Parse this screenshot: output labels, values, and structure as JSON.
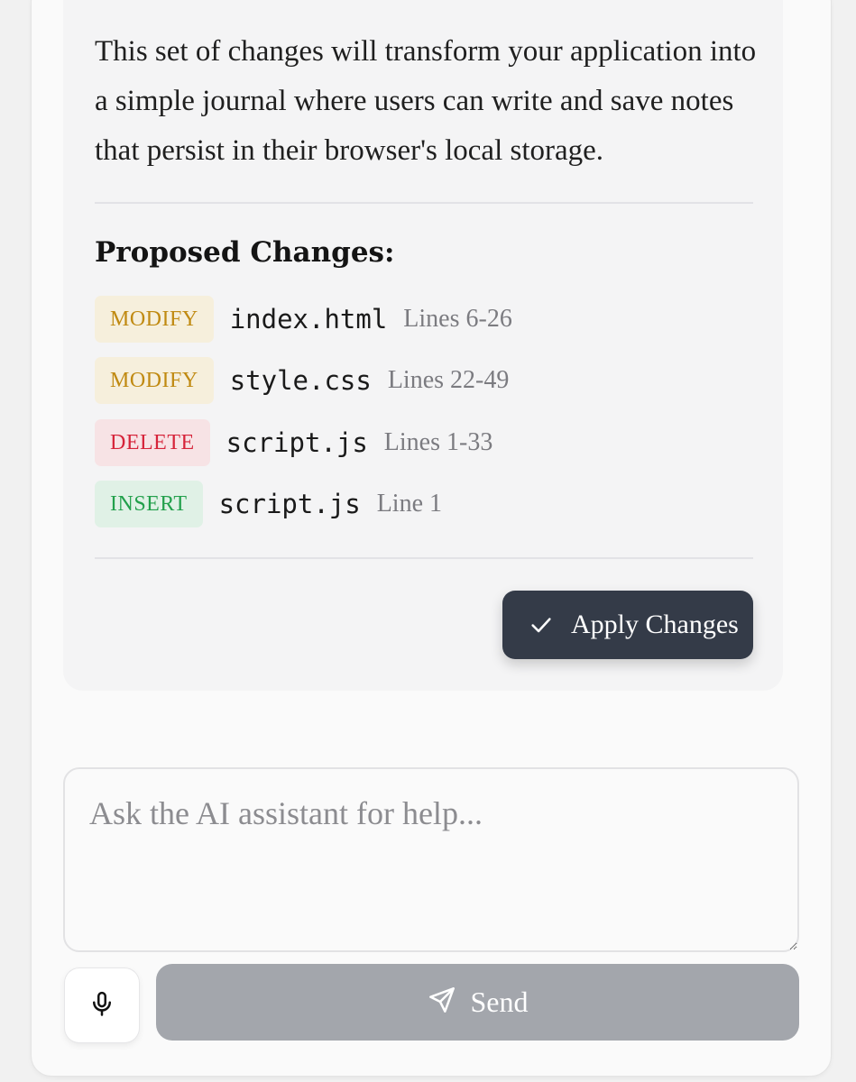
{
  "message": {
    "text": "This set of changes will transform your application into a simple journal where users can write and save notes that persist in their browser's local storage.",
    "changes_title": "Proposed Changes:",
    "changes": [
      {
        "action": "MODIFY",
        "file": "index.html",
        "lines": "Lines 6-26"
      },
      {
        "action": "MODIFY",
        "file": "style.css",
        "lines": "Lines 22-49"
      },
      {
        "action": "DELETE",
        "file": "script.js",
        "lines": "Lines 1-33"
      },
      {
        "action": "INSERT",
        "file": "script.js",
        "lines": "Line 1"
      }
    ],
    "apply_label": "Apply Changes"
  },
  "composer": {
    "placeholder": "Ask the AI assistant for help...",
    "value": "",
    "send_label": "Send"
  },
  "icons": {
    "apply": "check-icon",
    "mic": "microphone-icon",
    "send": "send-icon"
  },
  "colors": {
    "modify_badge_bg": "#f6efdc",
    "modify_badge_text": "#c08a12",
    "delete_badge_bg": "#f7e3e5",
    "delete_badge_text": "#d6243a",
    "insert_badge_bg": "#e0f1e6",
    "insert_badge_text": "#23a04c",
    "apply_button_bg": "#343b48",
    "send_button_bg": "#a3a6ac"
  }
}
